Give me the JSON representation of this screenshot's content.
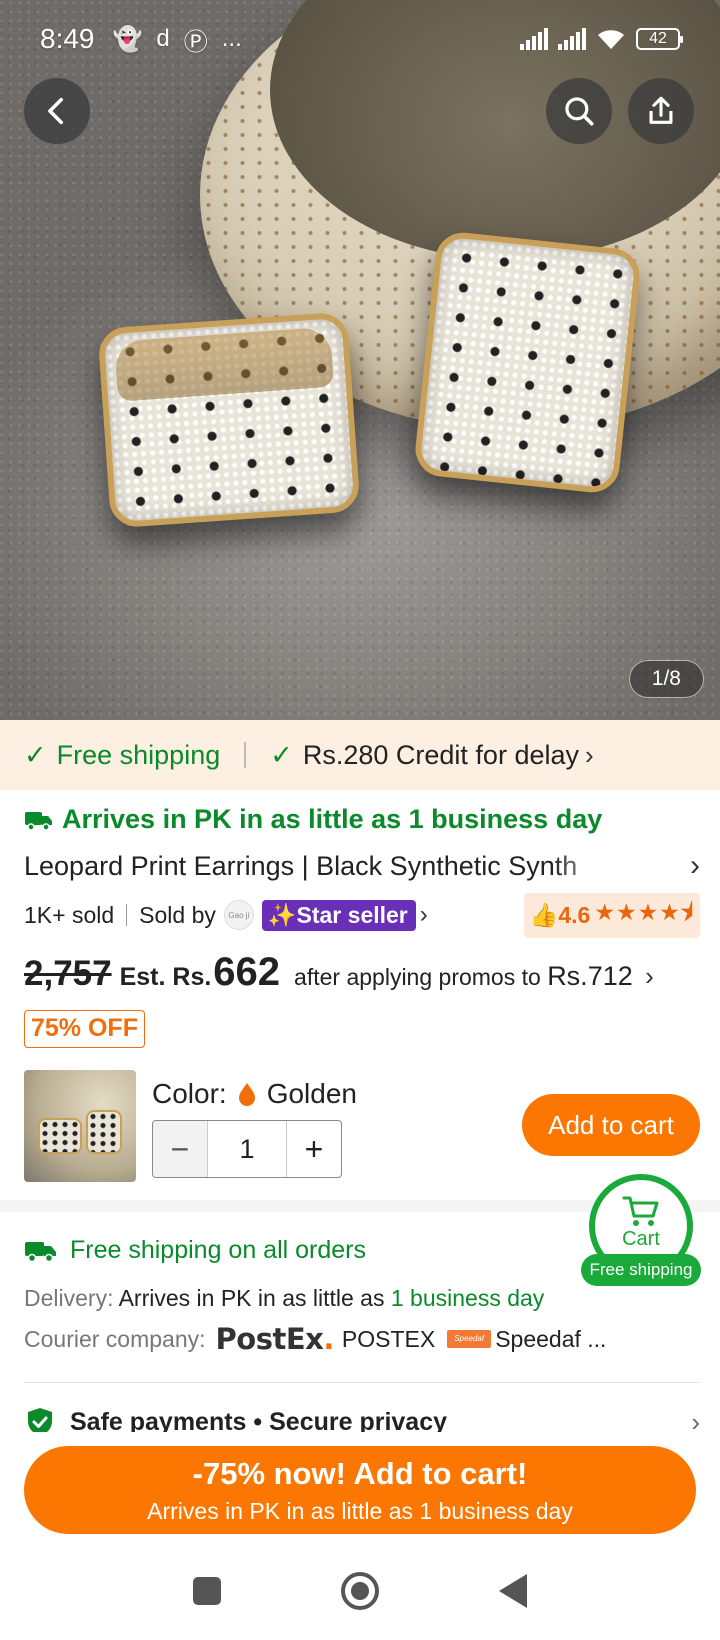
{
  "status_bar": {
    "time": "8:49",
    "notifications": [
      "snapchat-icon",
      "d",
      "pinterest-icon",
      "..."
    ],
    "battery": "42"
  },
  "gallery": {
    "counter": "1/8"
  },
  "promo_strip": {
    "free_shipping": "Free shipping",
    "credit": "Rs.280 Credit for delay"
  },
  "product": {
    "arrival": "Arrives in PK in as little as 1 business day",
    "title": "Leopard Print Earrings | Black Synthetic Synth",
    "sold": "1K+ sold",
    "sold_by": "Sold by",
    "shop_logo_text": "Gao ji",
    "badge": "Star seller",
    "rating": "4.6",
    "rating_value": 4.6
  },
  "pricing": {
    "original": "2,757",
    "est_label": "Est. Rs.",
    "price": "662",
    "after_text": "after applying promos to",
    "promo_price": "Rs.712",
    "discount": "75% OFF"
  },
  "variant": {
    "color_label": "Color:",
    "color_value": "Golden",
    "quantity": "1",
    "add_to_cart": "Add to cart"
  },
  "floating_cart": {
    "label": "Cart",
    "badge": "Free shipping"
  },
  "shipping": {
    "heading": "Free shipping on all orders",
    "delivery_label": "Delivery:",
    "delivery_text": "Arrives in PK in as little as",
    "delivery_highlight": "1 business day",
    "courier_label": "Courier company:",
    "courier_logo": "PostEx",
    "courier_name_1": "POSTEX",
    "courier_logo_2": "Speedaf",
    "courier_name_2": "Speedaf ..."
  },
  "safety": {
    "text": "Safe payments • Secure privacy"
  },
  "cta": {
    "line1": "-75% now! Add to cart!",
    "line2": "Arrives in PK in as little as 1 business day"
  },
  "colors": {
    "accent_orange": "#fb7701",
    "green": "#0a8a2a",
    "star_seller_purple": "#6a2fb8",
    "promo_bg": "#fdefe2"
  }
}
